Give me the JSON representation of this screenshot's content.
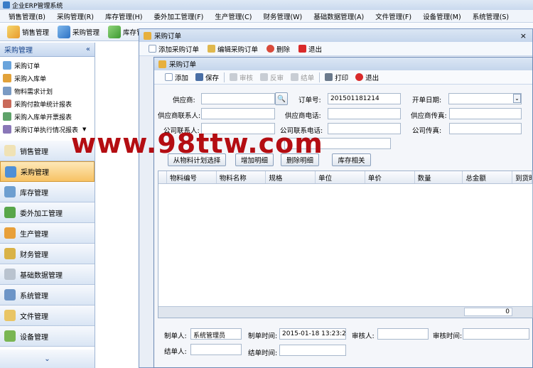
{
  "app": {
    "title": "企业ERP管理系统"
  },
  "menu": [
    "销售管理(B)",
    "采购管理(R)",
    "库存管理(H)",
    "委外加工管理(F)",
    "生产管理(C)",
    "财务管理(W)",
    "基础数据管理(A)",
    "文件管理(F)",
    "设备管理(M)",
    "系统管理(S)"
  ],
  "toolbar": {
    "items": [
      "销售管理",
      "采购管理",
      "库存管"
    ]
  },
  "sidebar": {
    "header": "采购管理",
    "collapse_glyph": "«",
    "items": [
      "采购订单",
      "采购入库单",
      "物料需求计划",
      "采购付款单统计报表",
      "采购入库单开票报表",
      "采购订单执行情况报表"
    ],
    "groups": [
      "销售管理",
      "采购管理",
      "库存管理",
      "委外加工管理",
      "生产管理",
      "财务管理",
      "基础数据管理",
      "系统管理",
      "文件管理",
      "设备管理"
    ],
    "footer_glyph": "⌄"
  },
  "outer_window": {
    "title": "采购订单",
    "tools": [
      "添加采购订单",
      "编辑采购订单",
      "删除",
      "退出"
    ]
  },
  "inner_window": {
    "title": "采购订单",
    "tools": {
      "add": "添加",
      "save": "保存",
      "audit": "审核",
      "unaudit": "反审",
      "close": "结单",
      "print": "打印",
      "exit": "退出"
    },
    "form": {
      "supplier_label": "供应商:",
      "supplier_value": "",
      "order_no_label": "订单号:",
      "order_no_value": "201501181214",
      "open_date_label": "开单日期:",
      "open_date_value": "",
      "supplier_contact_label": "供应商联系人:",
      "supplier_contact_value": "",
      "supplier_phone_label": "供应商电话:",
      "supplier_phone_value": "",
      "supplier_fax_label": "供应商传真:",
      "supplier_fax_value": "",
      "company_contact_label": "公司联系人:",
      "company_contact_value": "",
      "company_phone_label": "公司联系电话:",
      "company_phone_value": "",
      "company_fax_label": "公司传真:",
      "company_fax_value": ""
    },
    "buttons": {
      "from_plan": "从物料计划选择",
      "add_detail": "增加明细",
      "delete_detail": "删除明细",
      "stock": "库存相关"
    },
    "grid": {
      "columns": [
        "物料编号",
        "物料名称",
        "规格",
        "单位",
        "单价",
        "数量",
        "总金额",
        "到货时"
      ],
      "total": "0"
    },
    "footer": {
      "creator_label": "制单人:",
      "creator_value": "系统管理员",
      "create_time_label": "制单时间:",
      "create_time_value": "2015-01-18 13:23:22",
      "auditor_label": "审核人:",
      "auditor_value": "",
      "audit_time_label": "审核时间:",
      "audit_time_value": "",
      "closer_label": "结单人:",
      "closer_value": "",
      "close_time_label": "结单时间:",
      "close_time_value": ""
    }
  },
  "watermark": "www.98ttw.com",
  "colors": {
    "accent": "#15428b",
    "active_group": "#f7c264",
    "watermark": "#b40d12"
  }
}
